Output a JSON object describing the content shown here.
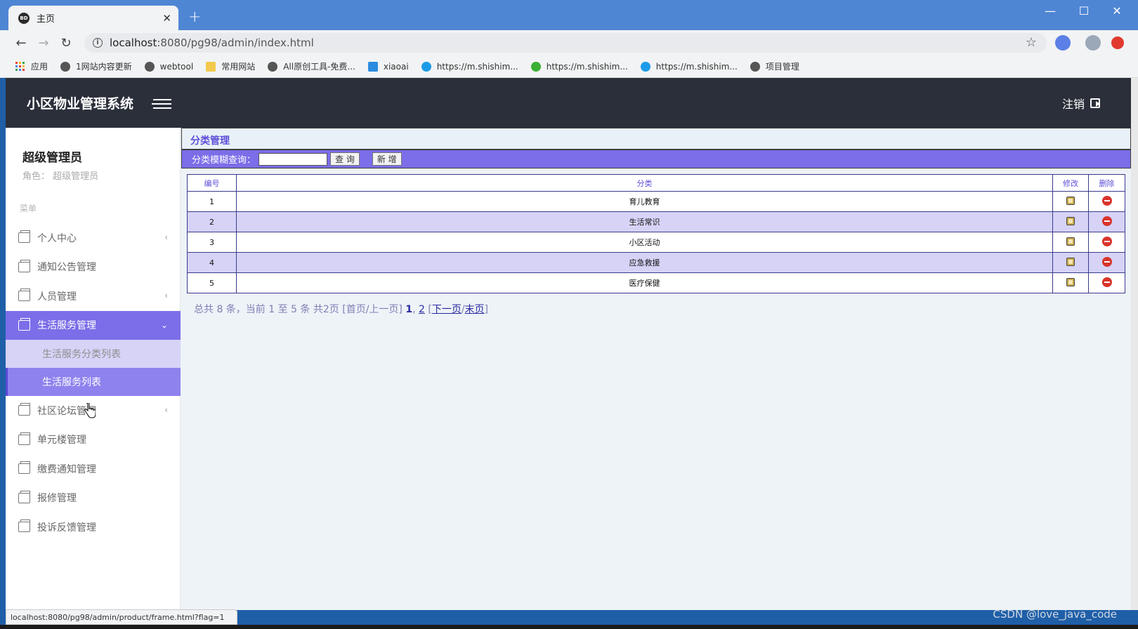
{
  "browser": {
    "tab_title": "主页",
    "tab_favicon": "BD",
    "url_host": "localhost",
    "url_path": ":8080/pg98/admin/index.html",
    "bookmarks": [
      {
        "label": "应用",
        "icon": "apps-grid-icon"
      },
      {
        "label": "1网站内容更新",
        "icon": "globe-icon"
      },
      {
        "label": "webtool",
        "icon": "globe-icon"
      },
      {
        "label": "常用网站",
        "icon": "folder-icon"
      },
      {
        "label": "All原创工具-免费...",
        "icon": "globe-icon"
      },
      {
        "label": "xiaoai",
        "icon": "p-icon"
      },
      {
        "label": "https://m.shishim...",
        "icon": "c-icon"
      },
      {
        "label": "https://m.shishim...",
        "icon": "wechat-icon"
      },
      {
        "label": "https://m.shishim...",
        "icon": "c-icon"
      },
      {
        "label": "项目管理",
        "icon": "globe-icon"
      }
    ],
    "status_url": "localhost:8080/pg98/admin/product/frame.html?flag=1"
  },
  "header": {
    "title": "小区物业管理系统",
    "logout": "注销"
  },
  "user": {
    "name": "超级管理员",
    "role_label": "角色：",
    "role": "超级管理员"
  },
  "sidebar": {
    "caption": "菜单",
    "items": [
      {
        "label": "个人中心",
        "caret": "‹"
      },
      {
        "label": "通知公告管理",
        "caret": ""
      },
      {
        "label": "人员管理",
        "caret": "‹"
      },
      {
        "label": "生活服务管理",
        "caret": "⌄"
      },
      {
        "label": "社区论坛管理",
        "caret": "‹"
      },
      {
        "label": "单元楼管理",
        "caret": ""
      },
      {
        "label": "缴费通知管理",
        "caret": ""
      },
      {
        "label": "报修管理",
        "caret": ""
      },
      {
        "label": "投诉反馈管理",
        "caret": ""
      }
    ],
    "subitems": [
      "生活服务分类列表",
      "生活服务列表"
    ]
  },
  "content": {
    "crumb": "分类管理",
    "search_label": "分类模糊查询：",
    "search_value": "",
    "query_button": "查 询",
    "add_button": "新 增",
    "columns": [
      "编号",
      "分类",
      "修改",
      "删除"
    ],
    "rows": [
      {
        "id": "1",
        "name": "育儿教育"
      },
      {
        "id": "2",
        "name": "生活常识"
      },
      {
        "id": "3",
        "name": "小区活动"
      },
      {
        "id": "4",
        "name": "应急救援"
      },
      {
        "id": "5",
        "name": "医疗保健"
      }
    ],
    "pager": {
      "summary": "总共 8 条，当前 1 至 5 条 共2页",
      "first_prev": "[首页/上一页]",
      "page1": "1",
      "comma": ",",
      "page2": "2",
      "open": "[",
      "next": "下一页",
      "slash": "/",
      "last": "末页",
      "close": "]"
    }
  },
  "watermark": "CSDN @love_java_code",
  "colors": {
    "accent": "#7b6ee8",
    "header_bg": "#2b2f3a",
    "row_alt": "#d6d3f7",
    "delete": "#d9342b"
  }
}
